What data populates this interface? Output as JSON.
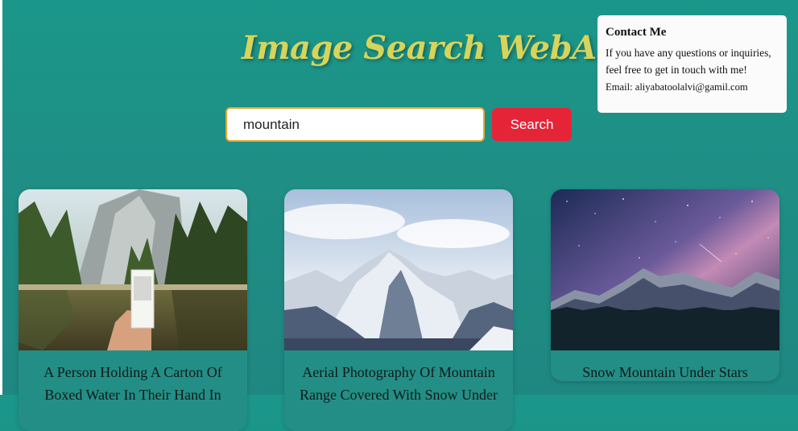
{
  "header": {
    "title": "Image Search WebApp"
  },
  "contact": {
    "title": "Contact Me",
    "message": "If you have any questions or inquiries, feel free to get in touch with me!",
    "email": "Email: aliyabatoolalvi@gamil.com"
  },
  "search": {
    "value": "mountain",
    "button_label": "Search"
  },
  "results": [
    {
      "caption": "A Person Holding A Carton Of Boxed Water In Their Hand In",
      "image": "lake-forest-carton-photo"
    },
    {
      "caption": "Aerial Photography Of Mountain Range Covered With Snow Under",
      "image": "snowy-mountain-range-photo"
    },
    {
      "caption": "Snow Mountain Under Stars",
      "image": "night-sky-mountain-photo"
    }
  ],
  "colors": {
    "accent": "#e62437",
    "title": "#d6d45b",
    "background": "#1b978a",
    "input_border": "#e4a72f"
  }
}
